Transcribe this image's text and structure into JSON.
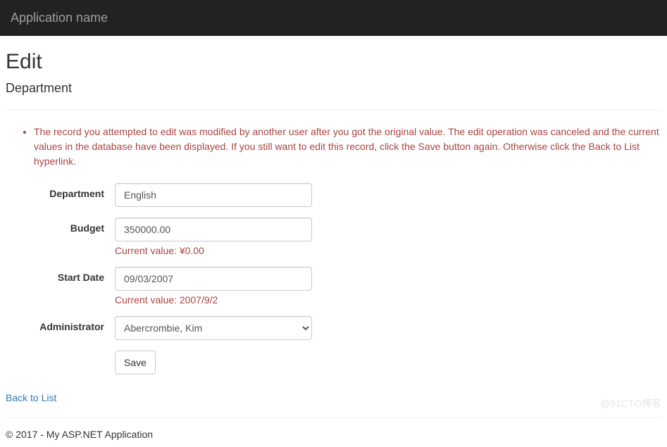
{
  "navbar": {
    "brand": "Application name"
  },
  "page": {
    "title": "Edit",
    "subtitle": "Department"
  },
  "validation": {
    "summary": "The record you attempted to edit was modified by another user after you got the original value. The edit operation was canceled and the current values in the database have been displayed. If you still want to edit this record, click the Save button again. Otherwise click the Back to List hyperlink."
  },
  "form": {
    "department": {
      "label": "Department",
      "value": "English"
    },
    "budget": {
      "label": "Budget",
      "value": "350000.00",
      "error": "Current value: ¥0.00"
    },
    "startDate": {
      "label": "Start Date",
      "value": "09/03/2007",
      "error": "Current value: 2007/9/2"
    },
    "administrator": {
      "label": "Administrator",
      "selected": "Abercrombie, Kim"
    },
    "save": "Save"
  },
  "links": {
    "backToList": "Back to List"
  },
  "footer": {
    "text": "© 2017 - My ASP.NET Application"
  },
  "watermark": "@51CTO博客"
}
